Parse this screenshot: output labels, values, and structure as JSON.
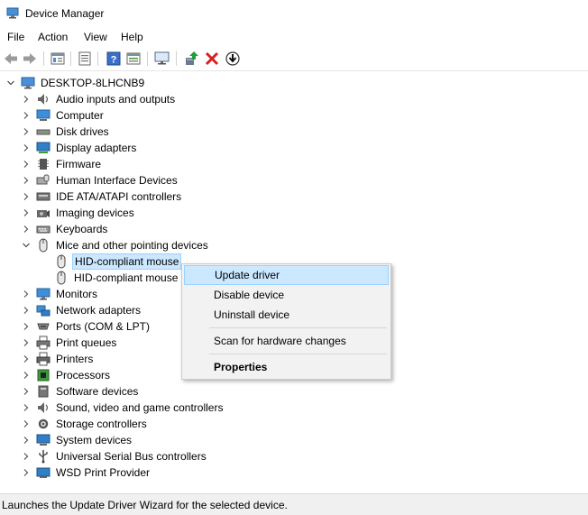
{
  "window": {
    "title": "Device Manager"
  },
  "menu": [
    "File",
    "Action",
    "View",
    "Help"
  ],
  "toolbar": {
    "buttons": [
      "back-icon",
      "forward-icon",
      "properties-view-icon",
      "list-view-icon",
      "help-icon",
      "details-view-icon",
      "scan-hardware-icon",
      "update-driver-icon",
      "uninstall-device-icon",
      "download-icon"
    ]
  },
  "tree": {
    "root": "DESKTOP-8LHCNB9",
    "categories": [
      "Audio inputs and outputs",
      "Computer",
      "Disk drives",
      "Display adapters",
      "Firmware",
      "Human Interface Devices",
      "IDE ATA/ATAPI controllers",
      "Imaging devices",
      "Keyboards",
      "Mice and other pointing devices",
      "Monitors",
      "Network adapters",
      "Ports (COM & LPT)",
      "Print queues",
      "Printers",
      "Processors",
      "Software devices",
      "Sound, video and game controllers",
      "Storage controllers",
      "System devices",
      "Universal Serial Bus controllers",
      "WSD Print Provider"
    ],
    "mice_children": [
      "HID-compliant mouse",
      "HID-compliant mouse"
    ]
  },
  "context_menu": {
    "update": "Update driver",
    "disable": "Disable device",
    "uninstall": "Uninstall device",
    "scan": "Scan for hardware changes",
    "properties": "Properties"
  },
  "status": "Launches the Update Driver Wizard for the selected device."
}
